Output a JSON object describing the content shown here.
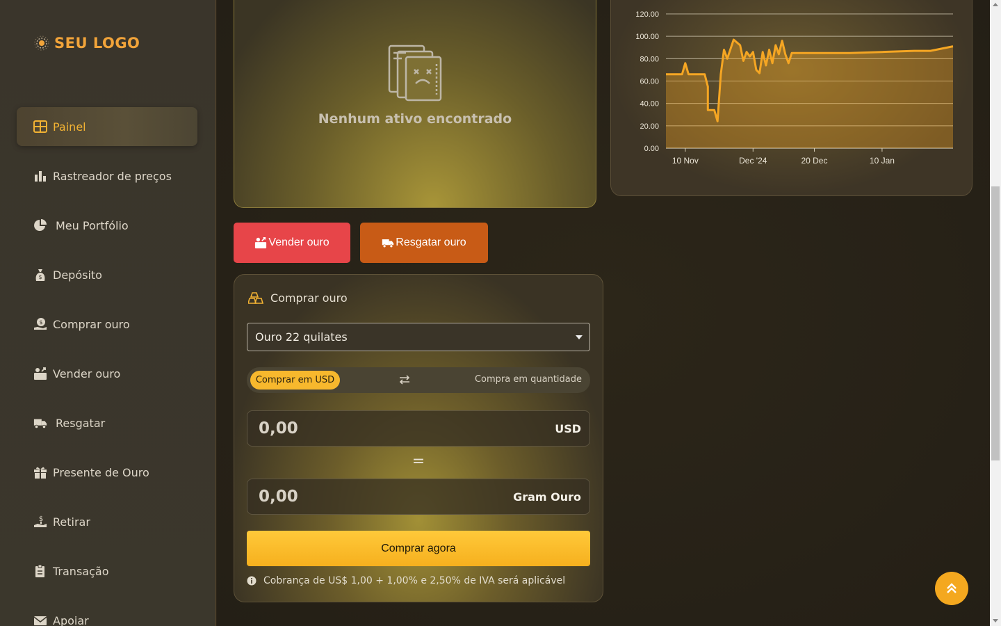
{
  "brand": {
    "logo_text": "SEU LOGO",
    "logo_icon": "gear-sun-icon",
    "accent": "#f2a43a"
  },
  "sidebar": {
    "items": [
      {
        "label": "Painel",
        "icon": "grid-icon",
        "active": true
      },
      {
        "label": "Rastreador de preços",
        "icon": "bar-chart-icon"
      },
      {
        "label": "Meu Portfólio",
        "icon": "pie-chart-icon"
      },
      {
        "label": "Depósito",
        "icon": "money-bag-icon"
      },
      {
        "label": "Comprar ouro",
        "icon": "hand-coin-icon"
      },
      {
        "label": "Vender ouro",
        "icon": "sell-icon"
      },
      {
        "label": "Resgatar",
        "icon": "truck-icon"
      },
      {
        "label": "Presente de Ouro",
        "icon": "gift-icon"
      },
      {
        "label": "Retirar",
        "icon": "hand-money-icon"
      },
      {
        "label": "Transação",
        "icon": "clipboard-icon"
      },
      {
        "label": "Apoiar",
        "icon": "envelope-icon"
      }
    ]
  },
  "assets": {
    "empty_text": "Nenhum ativo encontrado"
  },
  "actions": {
    "sell_label": "Vender ouro",
    "redeem_label": "Resgatar ouro"
  },
  "buy": {
    "title": "Comprar ouro",
    "select_value": "Ouro 22 quilates",
    "toggle_left": "Comprar em USD",
    "toggle_right": "Compra em quantidade",
    "amount_value": "0,00",
    "amount_unit": "USD",
    "equals": "=",
    "grams_value": "0,00",
    "grams_unit": "Gram Ouro",
    "button": "Comprar agora",
    "fee_note": "Cobrança de US$ 1,00 + 1,00% e 2,50% de IVA será aplicável"
  },
  "colors": {
    "sell": "#e74549",
    "redeem": "#c85b16",
    "buy": "#f6b01e",
    "line": "#f5a623"
  },
  "chart_data": {
    "type": "area",
    "yticks": [
      "0.00",
      "20.00",
      "40.00",
      "60.00",
      "80.00",
      "100.00",
      "120.00"
    ],
    "ylim": [
      0,
      120
    ],
    "xticks": [
      {
        "label": "10 Nov",
        "x": "2024-11-10"
      },
      {
        "label": "Dec '24",
        "x": "2024-12-01"
      },
      {
        "label": "20 Dec",
        "x": "2024-12-20"
      },
      {
        "label": "10 Jan",
        "x": "2025-01-10"
      }
    ],
    "xlim": [
      "2024-11-04",
      "2025-02-01"
    ],
    "series": [
      {
        "points": [
          [
            "2024-11-04",
            66
          ],
          [
            "2024-11-09",
            66
          ],
          [
            "2024-11-10",
            76
          ],
          [
            "2024-11-11",
            66
          ],
          [
            "2024-11-15",
            66
          ],
          [
            "2024-11-16",
            66
          ],
          [
            "2024-11-17",
            55
          ],
          [
            "2024-11-17",
            34
          ],
          [
            "2024-11-19",
            34
          ],
          [
            "2024-11-20",
            24
          ],
          [
            "2024-11-21",
            66
          ],
          [
            "2024-11-22",
            88
          ],
          [
            "2024-11-23",
            80
          ],
          [
            "2024-11-25",
            97
          ],
          [
            "2024-11-27",
            92
          ],
          [
            "2024-11-28",
            78
          ],
          [
            "2024-11-29",
            86
          ],
          [
            "2024-11-30",
            82
          ],
          [
            "2024-12-01",
            86
          ],
          [
            "2024-12-02",
            70
          ],
          [
            "2024-12-03",
            67
          ],
          [
            "2024-12-04",
            86
          ],
          [
            "2024-12-05",
            74
          ],
          [
            "2024-12-06",
            88
          ],
          [
            "2024-12-07",
            76
          ],
          [
            "2024-12-08",
            92
          ],
          [
            "2024-12-09",
            84
          ],
          [
            "2024-12-10",
            96
          ],
          [
            "2024-12-11",
            84
          ],
          [
            "2024-12-12",
            76
          ],
          [
            "2024-12-13",
            85
          ],
          [
            "2024-12-20",
            85
          ],
          [
            "2024-12-31",
            85
          ],
          [
            "2025-01-10",
            86
          ],
          [
            "2025-01-20",
            87
          ],
          [
            "2025-01-25",
            87
          ],
          [
            "2025-02-01",
            91
          ]
        ]
      }
    ]
  }
}
